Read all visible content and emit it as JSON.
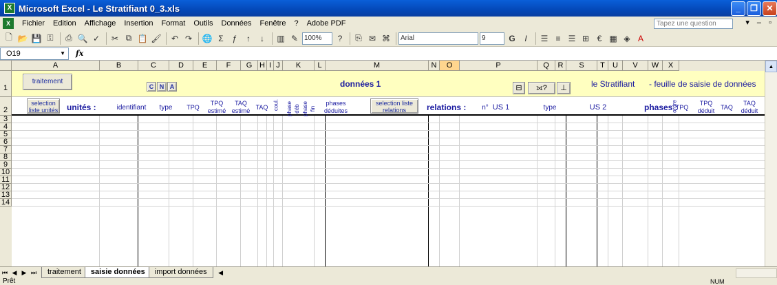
{
  "window": {
    "title": "Microsoft Excel - Le Stratifiant 0_3.xls",
    "app_icon": "excel-icon"
  },
  "menu": [
    "Fichier",
    "Edition",
    "Affichage",
    "Insertion",
    "Format",
    "Outils",
    "Données",
    "Fenêtre",
    "?",
    "Adobe PDF"
  ],
  "ask_placeholder": "Tapez une question",
  "toolbar": {
    "zoom": "100%",
    "font": "Arial",
    "font_size": "9",
    "bold": "G",
    "italic": "I",
    "currency": "€"
  },
  "namebox": "O19",
  "fx_label": "fx",
  "columns": [
    "A",
    "B",
    "C",
    "D",
    "E",
    "F",
    "G",
    "H",
    "I",
    "J",
    "K",
    "L",
    "M",
    "N",
    "O",
    "P",
    "Q",
    "R",
    "S",
    "T",
    "U",
    "V",
    "W",
    "X"
  ],
  "rows": [
    "1",
    "2",
    "3",
    "4",
    "5",
    "6",
    "7",
    "8",
    "9",
    "10",
    "11",
    "12",
    "13",
    "14"
  ],
  "row1": {
    "traitement_button": "traitement",
    "cna_buttons": [
      "C",
      "N",
      "A"
    ],
    "donnees_title": "données 1",
    "stratifiant_label": "le Stratifiant",
    "feuille_label": "- feuille de saisie de données"
  },
  "row2": {
    "selection_unites": "selection liste unités",
    "unites_label": "unités :",
    "identifiant": "identifiant",
    "type": "type",
    "tpq": "TPQ",
    "tpq_estime": "TPQ estimé",
    "taq_estime": "TAQ estimé",
    "taq": "TAQ",
    "coul": "coul.",
    "phase_deb": "phase déb",
    "phase_fin": "phase fin",
    "phases_deduites": "phases déduites",
    "selection_relations": "selection liste relations",
    "relations_label": "relations :",
    "n_label": "n°",
    "us1": "US 1",
    "type_rel": "type",
    "us2": "US 2",
    "phases_label": "phases :",
    "ordre": "ordre",
    "tpq2": "TPQ",
    "tpq_deduit": "TPQ déduit",
    "taq2": "TAQ",
    "taq_deduit": "TAQ déduit"
  },
  "tabs": [
    "traitement",
    "saisie données",
    "import données"
  ],
  "active_tab": "saisie données",
  "status": {
    "left": "Prêt",
    "right": "NUM"
  }
}
